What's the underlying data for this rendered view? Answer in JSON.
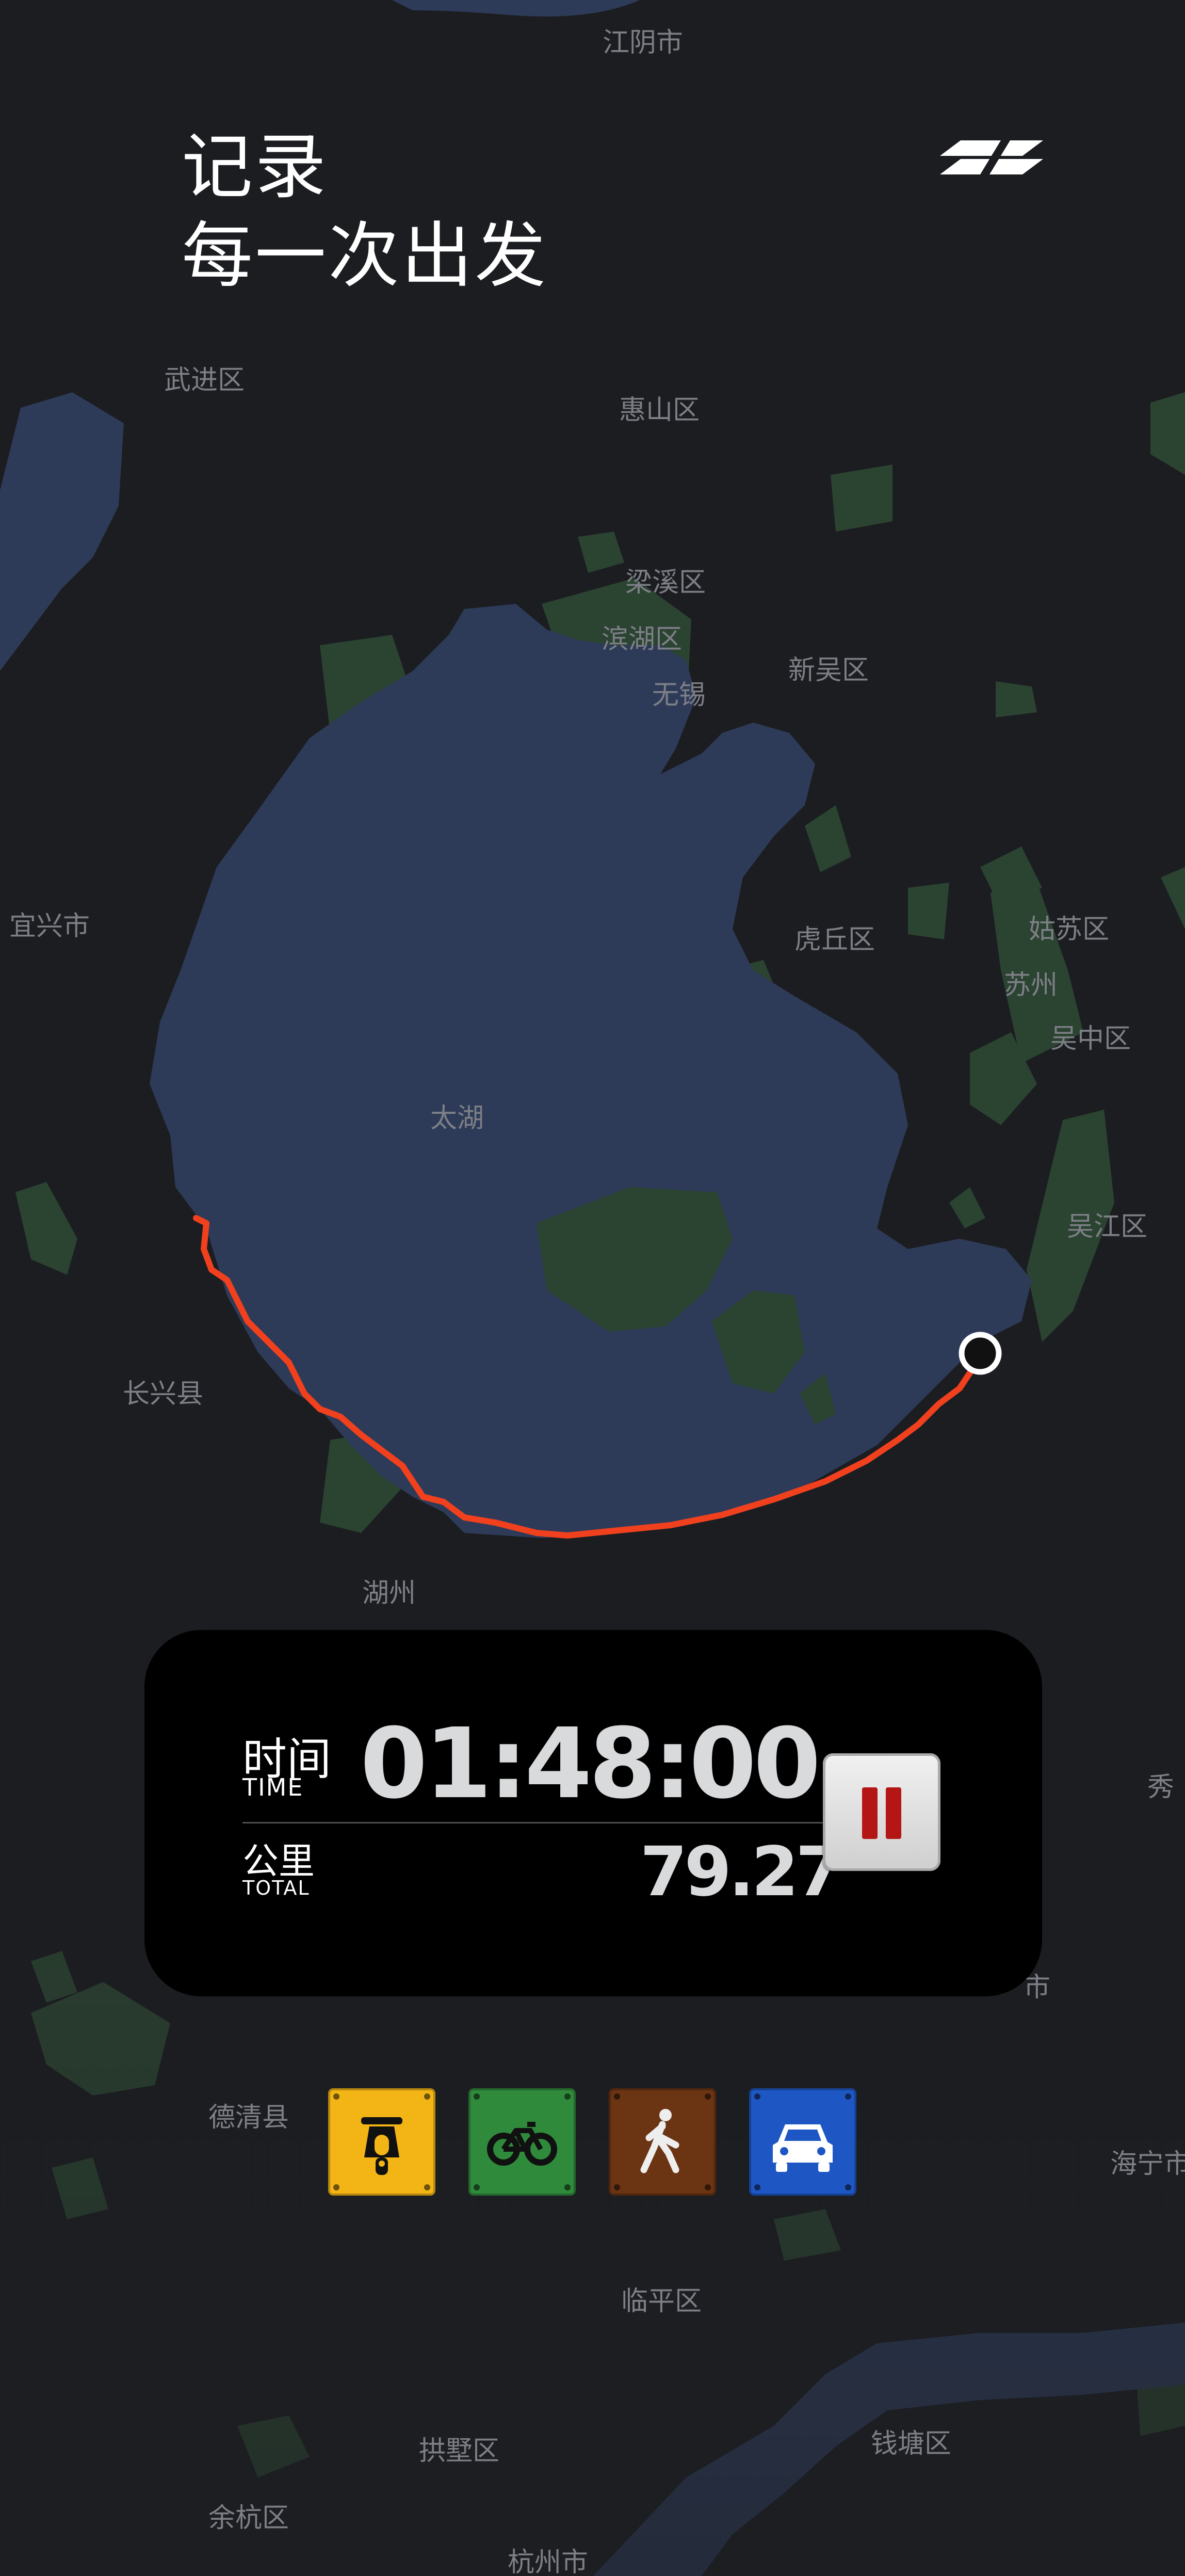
{
  "headline": {
    "line1": "记录",
    "line2": "每一次出发"
  },
  "map": {
    "places": [
      "江阴市",
      "武进区",
      "惠山区",
      "梁溪区",
      "滨湖区",
      "无锡",
      "新吴区",
      "宜兴市",
      "虎丘区",
      "姑苏区",
      "苏州",
      "吴中区",
      "太湖",
      "吴江区",
      "长兴县",
      "湖州",
      "秀",
      "市",
      "德清县",
      "海宁市",
      "临平区",
      "拱墅区",
      "钱塘区",
      "余杭区",
      "杭州市"
    ]
  },
  "stats": {
    "time_label_cn": "时间",
    "time_label_en": "TIME",
    "time_value": "01:48:00",
    "distance_label_cn": "公里",
    "distance_label_en": "TOTAL",
    "distance_value": "79.27"
  },
  "modes": [
    {
      "name": "scooter",
      "icon": "scooter-icon",
      "color": "#f2b515"
    },
    {
      "name": "bicycle",
      "icon": "bicycle-icon",
      "color": "#2f8a3b"
    },
    {
      "name": "walk",
      "icon": "walking-icon",
      "color": "#6b3413"
    },
    {
      "name": "car",
      "icon": "car-icon",
      "color": "#1e57c4"
    }
  ],
  "colors": {
    "route": "#f0401e",
    "water": "#2d3b58",
    "land": "#1c1d21",
    "vegetation": "#2b4331"
  }
}
